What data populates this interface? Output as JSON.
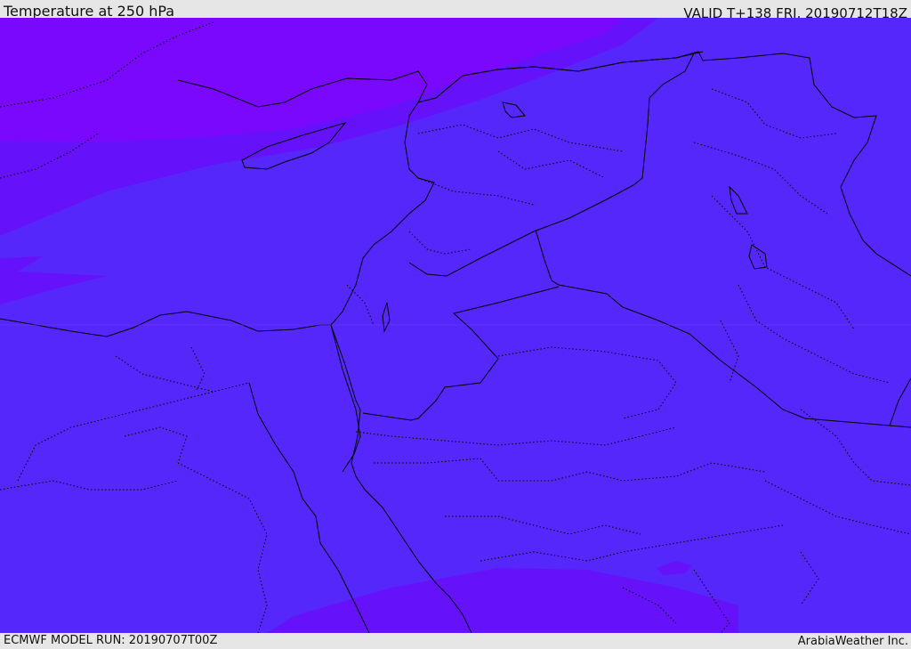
{
  "header": {
    "title": "Temperature at 250 hPa",
    "valid_time": "VALID T+138 FRI. 20190712T18Z"
  },
  "footer": {
    "model_run": "ECMWF MODEL RUN: 20190707T00Z",
    "credit": "ArabiaWeather Inc."
  },
  "map": {
    "variable": "temperature",
    "level": "250 hPa",
    "colors": {
      "cold_band": "#7a08fc",
      "mid_band": "#6512fb",
      "main_field": "#5627fb",
      "boundary_line": "#000000"
    }
  }
}
